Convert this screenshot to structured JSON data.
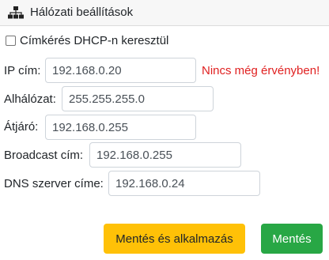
{
  "header": {
    "title": "Hálózati beállítások",
    "icon": "network-icon"
  },
  "dhcp": {
    "label": "Címkérés DHCP-n keresztül",
    "checked": false
  },
  "fields": {
    "ip": {
      "label": "IP cím:",
      "value": "192.168.0.20"
    },
    "subnet": {
      "label": "Alhálózat:",
      "value": "255.255.255.0"
    },
    "gateway": {
      "label": "Átjáró:",
      "value": "192.168.0.255"
    },
    "broadcast": {
      "label": "Broadcast cím:",
      "value": "192.168.0.255"
    },
    "dns": {
      "label": "DNS szerver címe:",
      "value": "192.168.0.24"
    }
  },
  "warning": "Nincs még érvényben!",
  "buttons": {
    "apply": "Mentés és alkalmazás",
    "save": "Mentés"
  },
  "colors": {
    "warning": "#e02020",
    "apply_button": "#ffc107",
    "save_button": "#28a745"
  }
}
